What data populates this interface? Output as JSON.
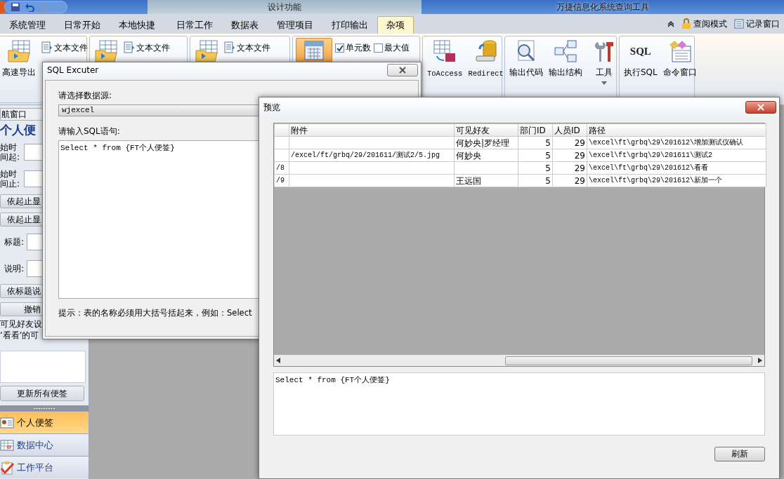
{
  "window": {
    "title": "万捷信息化系统查询工具",
    "context_tab": "设计功能"
  },
  "ribbon_tabs": [
    {
      "label": "系统管理",
      "selected": false
    },
    {
      "label": "日常开始",
      "selected": false
    },
    {
      "label": "本地快捷",
      "selected": false
    },
    {
      "label": "日常工作",
      "selected": false
    },
    {
      "label": "数据表",
      "selected": false
    },
    {
      "label": "管理项目",
      "selected": false
    },
    {
      "label": "打印输出",
      "selected": false
    },
    {
      "label": "杂项",
      "selected": true
    }
  ],
  "ribbon_right": [
    {
      "label": "查阅模式",
      "kind": "lock"
    },
    {
      "label": "记录窗口",
      "kind": "list"
    }
  ],
  "ribbon_groups": [
    {
      "items": [
        {
          "kind": "large",
          "label": "高速导出"
        },
        {
          "kind": "small",
          "label": "文本文件"
        }
      ]
    },
    {
      "items": [
        {
          "kind": "large"
        },
        {
          "kind": "small",
          "label": "文本文件"
        }
      ]
    },
    {
      "items": [
        {
          "kind": "large"
        },
        {
          "kind": "small",
          "label": "文本文件"
        }
      ]
    },
    {
      "items": [
        {
          "kind": "large",
          "highlighted": true
        },
        {
          "kind": "check",
          "label": "单元数",
          "checked": true
        },
        {
          "kind": "check",
          "label": "最大值",
          "checked": false
        }
      ]
    },
    {
      "items": [
        {
          "kind": "large",
          "label": "ToAccess"
        },
        {
          "kind": "large",
          "label": "Redirect"
        }
      ]
    },
    {
      "items": [
        {
          "kind": "large",
          "label": "输出代码"
        },
        {
          "kind": "large",
          "label": "输出结构"
        },
        {
          "kind": "dropdown",
          "label": "工具"
        }
      ]
    },
    {
      "items": [
        {
          "kind": "large",
          "label": "执行SQL",
          "icon_text": "SQL"
        },
        {
          "kind": "large",
          "label": "命令窗口"
        }
      ]
    }
  ],
  "nav_pane": {
    "title": "航窗口",
    "heading": "个人便",
    "controls": [
      {
        "kind": "field",
        "label": "始时间起:"
      },
      {
        "kind": "field",
        "label": "始时间止:"
      },
      {
        "kind": "button",
        "label": "依起止显"
      },
      {
        "kind": "button",
        "label": "依起止显"
      },
      {
        "kind": "field",
        "label": "标题:"
      },
      {
        "kind": "field",
        "label": "说明:"
      },
      {
        "kind": "button",
        "label": "依标题说"
      },
      {
        "kind": "button",
        "label": "撤销"
      },
      {
        "kind": "text",
        "label": "可见好友设"
      },
      {
        "kind": "text",
        "label": "‘看看’的可"
      }
    ],
    "update_button": "更新所有便签",
    "nav_buttons": [
      {
        "label": "个人便签",
        "selected": true
      },
      {
        "label": "数据中心",
        "selected": false
      },
      {
        "label": "工作平台",
        "selected": false
      }
    ]
  },
  "sql_dialog": {
    "title": "SQL Excuter",
    "source_label": "请选择数据源:",
    "source_value": "wjexcel",
    "sql_label": "请输入SQL语句:",
    "sql_value": "Select * from {FT个人便签}",
    "hint": "提示：表的名称必须用大括号括起来，例如：Select"
  },
  "preview_dialog": {
    "title": "预览",
    "table": {
      "columns": [
        null,
        "附件",
        "可见好友",
        "部门ID",
        "人员ID",
        "路径"
      ],
      "rows": [
        [
          null,
          null,
          "何妙央|罗经理",
          "5",
          "29",
          "\\excel\\ft\\grbq\\29\\201612\\增加测试仪确认"
        ],
        [
          null,
          "/excel/ft/grbq/29/201611/测试2/5.jpg",
          "何妙央",
          "5",
          "29",
          "\\excel\\ft\\grbq\\29\\201611\\测试2"
        ],
        [
          "/8",
          null,
          null,
          "5",
          "29",
          "\\excel\\ft\\grbq\\29\\201612\\看看"
        ],
        [
          "/9",
          null,
          "王远国",
          "5",
          "29",
          "\\excel\\ft\\grbq\\29\\201612\\新加一个"
        ]
      ]
    },
    "sql_value": "Select * from {FT个人便签}",
    "refresh_button": "刷新"
  }
}
